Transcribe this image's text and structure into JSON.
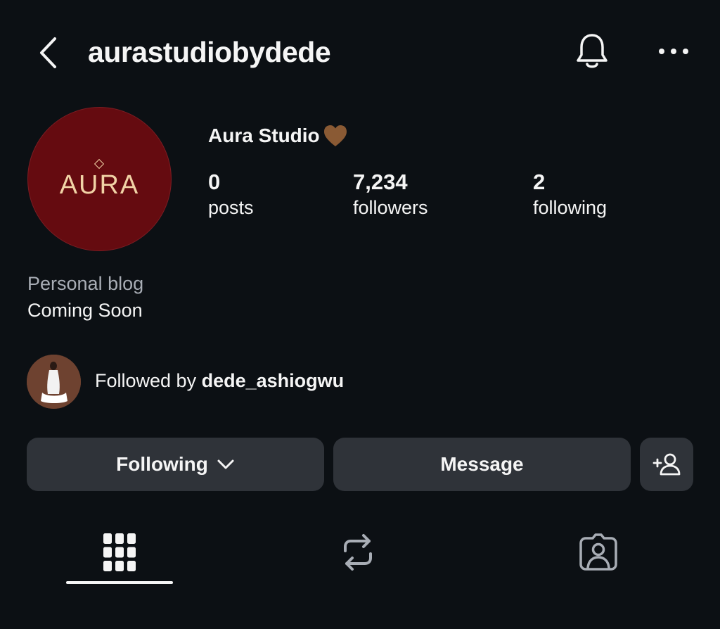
{
  "header": {
    "username": "aurastudiobydede",
    "back_icon": "chevron-left-icon",
    "bell_icon": "bell-icon",
    "more_icon": "more-horizontal-icon"
  },
  "profile": {
    "avatar_text": "AURA",
    "avatar_bg": "#650b10",
    "avatar_fg": "#f1d3a6",
    "display_name": "Aura Studio",
    "name_emoji": "brown-heart-icon",
    "stats": [
      {
        "value": "0",
        "label": "posts"
      },
      {
        "value": "7,234",
        "label": "followers"
      },
      {
        "value": "2",
        "label": "following"
      }
    ],
    "category": "Personal blog",
    "bio": "Coming Soon"
  },
  "followed_by": {
    "prefix": "Followed by",
    "user": "dede_ashiogwu"
  },
  "actions": {
    "following_label": "Following",
    "message_label": "Message",
    "add_user_icon": "add-user-icon"
  },
  "tabs": [
    {
      "name": "grid",
      "icon": "grid-icon",
      "active": true
    },
    {
      "name": "reposts",
      "icon": "repost-icon",
      "active": false
    },
    {
      "name": "tagged",
      "icon": "tagged-icon",
      "active": false
    }
  ],
  "colors": {
    "background": "#0c1014",
    "button_bg": "#2f3339",
    "muted_text": "#a8adb5"
  }
}
